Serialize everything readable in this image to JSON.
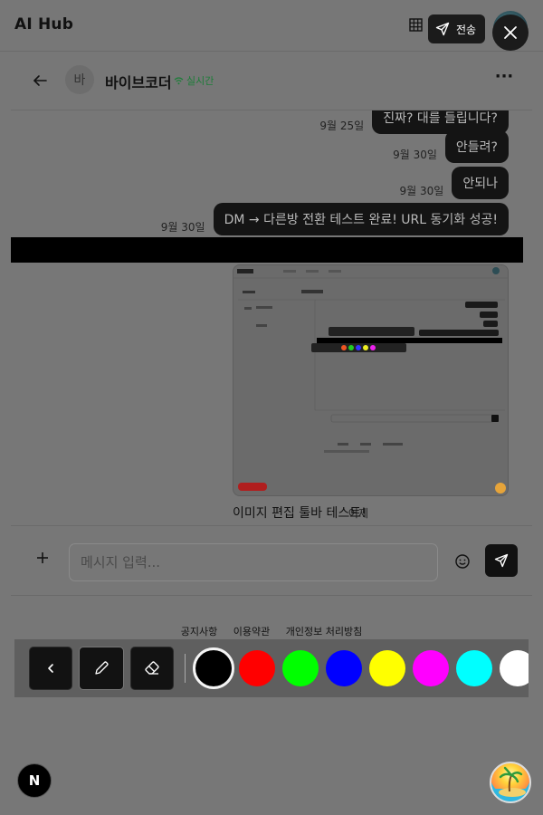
{
  "app": {
    "title": "AI Hub"
  },
  "topbar": {
    "send_label": "전송",
    "grid_icon": "grid-icon",
    "close_icon": "close-icon"
  },
  "chat": {
    "avatar_initial": "바",
    "name": "바이브코더",
    "status": "실시간"
  },
  "messages": [
    {
      "time": "9월 25일",
      "text": "진짜? 대를 들립니다?"
    },
    {
      "time": "9월 30일",
      "text": "안들려?"
    },
    {
      "time": "9월 30일",
      "text": "안되나"
    },
    {
      "time": "9월 30일",
      "text": "DM → 다른방 전환 테스트 완료! URL 동기화 성공!"
    }
  ],
  "image_message": {
    "time": "어제",
    "text": "이미지 편집 툴바 테스트!"
  },
  "composer": {
    "placeholder": "메시지 입력..."
  },
  "footer": {
    "links": [
      "공지사항",
      "이용약관",
      "개인정보 처리방침"
    ]
  },
  "toolbar": {
    "tools": [
      "chevron-left-icon",
      "pen-icon",
      "eraser-icon"
    ],
    "colors": [
      "#000000",
      "#ff0000",
      "#00ff00",
      "#0000ff",
      "#ffff00",
      "#ff00ff",
      "#00ffff",
      "#ffffff"
    ],
    "selected_color": "#000000"
  },
  "badge": {
    "letter": "N"
  }
}
